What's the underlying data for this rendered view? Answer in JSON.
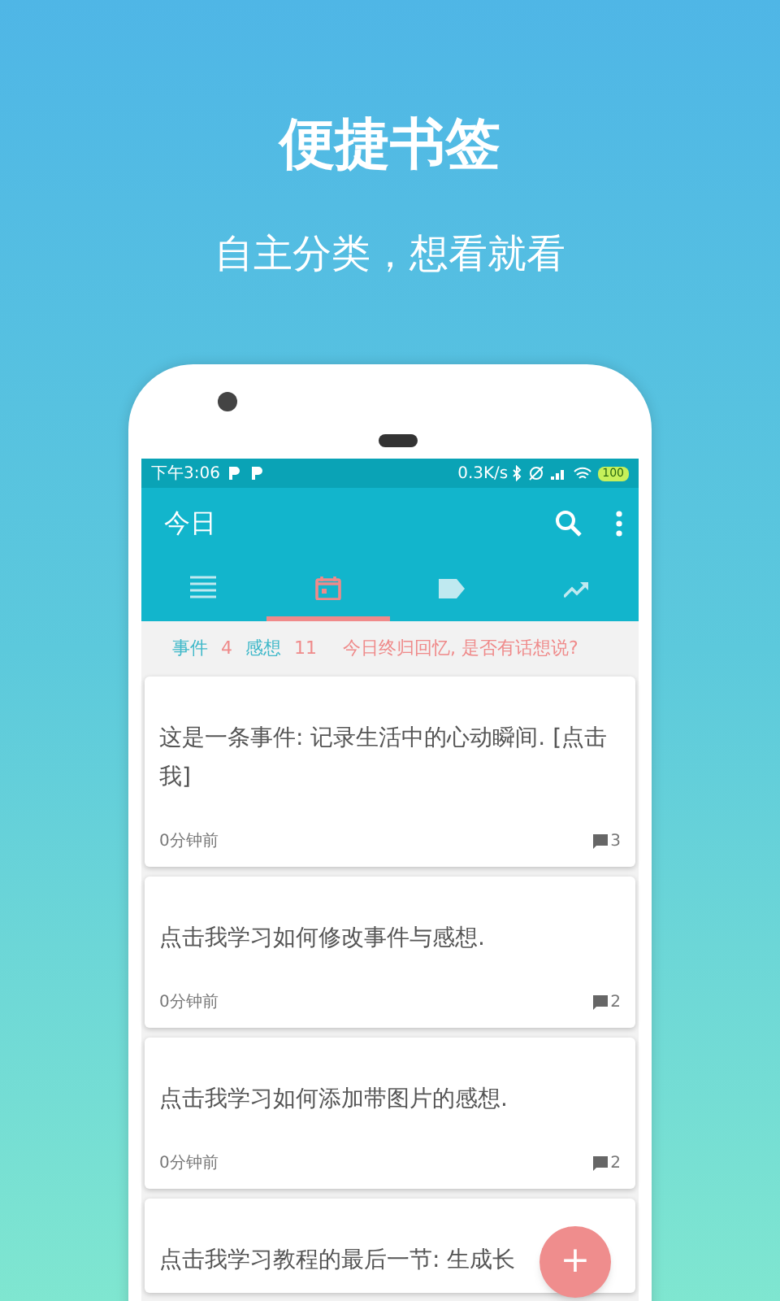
{
  "promo": {
    "title": "便捷书签",
    "subtitle": "自主分类，想看就看"
  },
  "status_bar": {
    "time": "下午3:06",
    "speed": "0.3K/s",
    "battery": "100"
  },
  "app_bar": {
    "title": "今日"
  },
  "tabs": [
    {
      "kind": "list",
      "selected": false
    },
    {
      "kind": "calendar",
      "selected": true
    },
    {
      "kind": "tag",
      "selected": false
    },
    {
      "kind": "trend",
      "selected": false
    }
  ],
  "summary": {
    "events_label": "事件",
    "events_count": "4",
    "thoughts_label": "感想",
    "thoughts_count": "11",
    "prompt": "今日终归回忆, 是否有话想说?"
  },
  "cards": [
    {
      "text": "这是一条事件: 记录生活中的心动瞬间. [点击我]",
      "time": "0分钟前",
      "comments": "3"
    },
    {
      "text": "点击我学习如何修改事件与感想.",
      "time": "0分钟前",
      "comments": "2"
    },
    {
      "text": "点击我学习如何添加带图片的感想.",
      "time": "0分钟前",
      "comments": "2"
    },
    {
      "text": "点击我学习教程的最后一节: 生成长"
    }
  ],
  "fab": {
    "label": "+"
  }
}
